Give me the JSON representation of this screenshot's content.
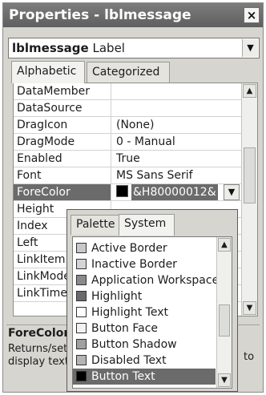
{
  "window": {
    "title": "Properties - lblmessage",
    "close_glyph": "×"
  },
  "object_selector": {
    "name": "lblmessage",
    "type": "Label",
    "arrow": "▼"
  },
  "tabs": [
    {
      "label": "Alphabetic",
      "active": true
    },
    {
      "label": "Categorized",
      "active": false
    }
  ],
  "properties": [
    {
      "name": "DataMember",
      "value": ""
    },
    {
      "name": "DataSource",
      "value": ""
    },
    {
      "name": "DragIcon",
      "value": "(None)"
    },
    {
      "name": "DragMode",
      "value": "0 - Manual"
    },
    {
      "name": "Enabled",
      "value": "True"
    },
    {
      "name": "Font",
      "value": "MS Sans Serif"
    },
    {
      "name": "ForeColor",
      "value": "&H80000012&",
      "selected": true
    },
    {
      "name": "Height",
      "value": ""
    },
    {
      "name": "Index",
      "value": ""
    },
    {
      "name": "Left",
      "value": ""
    },
    {
      "name": "LinkItem",
      "value": ""
    },
    {
      "name": "LinkMode",
      "value": ""
    },
    {
      "name": "LinkTimeout",
      "value": ""
    }
  ],
  "color_popup": {
    "tabs": [
      {
        "label": "Palette",
        "active": false
      },
      {
        "label": "System",
        "active": true
      }
    ],
    "items": [
      {
        "label": "Active Border",
        "swatch": "#c8c8c8"
      },
      {
        "label": "Inactive Border",
        "swatch": "#d4d4d4"
      },
      {
        "label": "Application Workspace",
        "swatch": "#8a8a8a"
      },
      {
        "label": "Highlight",
        "swatch": "#6a6a6a"
      },
      {
        "label": "Highlight Text",
        "swatch": "#ffffff"
      },
      {
        "label": "Button Face",
        "swatch": "#f2f2f2"
      },
      {
        "label": "Button Shadow",
        "swatch": "#a0a0a0"
      },
      {
        "label": "Disabled Text",
        "swatch": "#b4b4b4"
      },
      {
        "label": "Button Text",
        "swatch": "#000000",
        "selected": true
      }
    ]
  },
  "description": {
    "title": "ForeColor",
    "text_line1": "Returns/sets the foreground color used to",
    "text_line2": "display text and graphics in an object.",
    "tail": "to"
  },
  "colors": {
    "selection": "#6b6b6b",
    "titlebar": "#6e6e6e",
    "window_bg": "#d6d5cf"
  }
}
